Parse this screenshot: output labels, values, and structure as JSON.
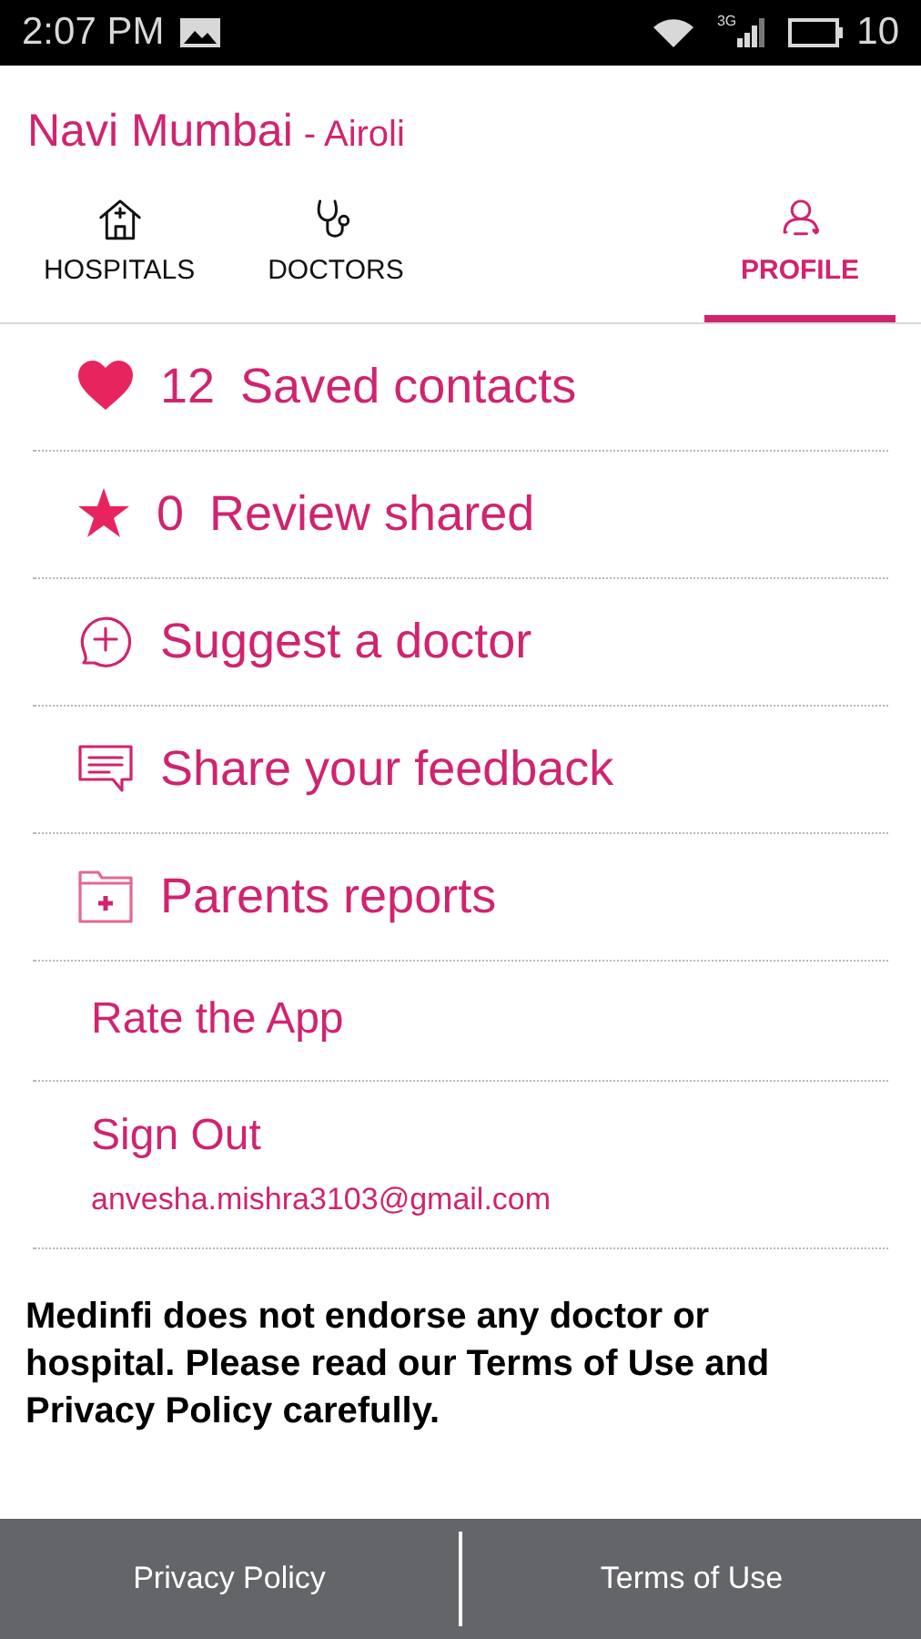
{
  "status_bar": {
    "time": "2:07 PM",
    "network": "3G",
    "battery": "10"
  },
  "header": {
    "city": "Navi Mumbai",
    "area": "- Airoli"
  },
  "tabs": [
    {
      "label": "HOSPITALS",
      "kind": "hospital",
      "selected": false
    },
    {
      "label": "DOCTORS",
      "kind": "stethoscope",
      "selected": false
    },
    {
      "label": "PROFILE",
      "kind": "profile",
      "selected": true
    }
  ],
  "menu": [
    {
      "kind": "heart",
      "count": "12",
      "label": "Saved contacts"
    },
    {
      "kind": "star",
      "count": "0",
      "label": "Review shared"
    },
    {
      "kind": "suggest",
      "label": "Suggest a doctor"
    },
    {
      "kind": "feedback",
      "label": "Share your feedback"
    },
    {
      "kind": "folder",
      "label": "Parents reports"
    },
    {
      "kind": "plain",
      "label": "Rate the App"
    },
    {
      "kind": "plain",
      "label": "Sign Out",
      "detail": "anvesha.mishra3103@gmail.com"
    }
  ],
  "disclaimer": "Medinfi does not endorse any doctor or hospital. Please read our Terms of Use and Privacy Policy carefully.",
  "footer": [
    "Privacy Policy",
    "Terms of Use"
  ]
}
